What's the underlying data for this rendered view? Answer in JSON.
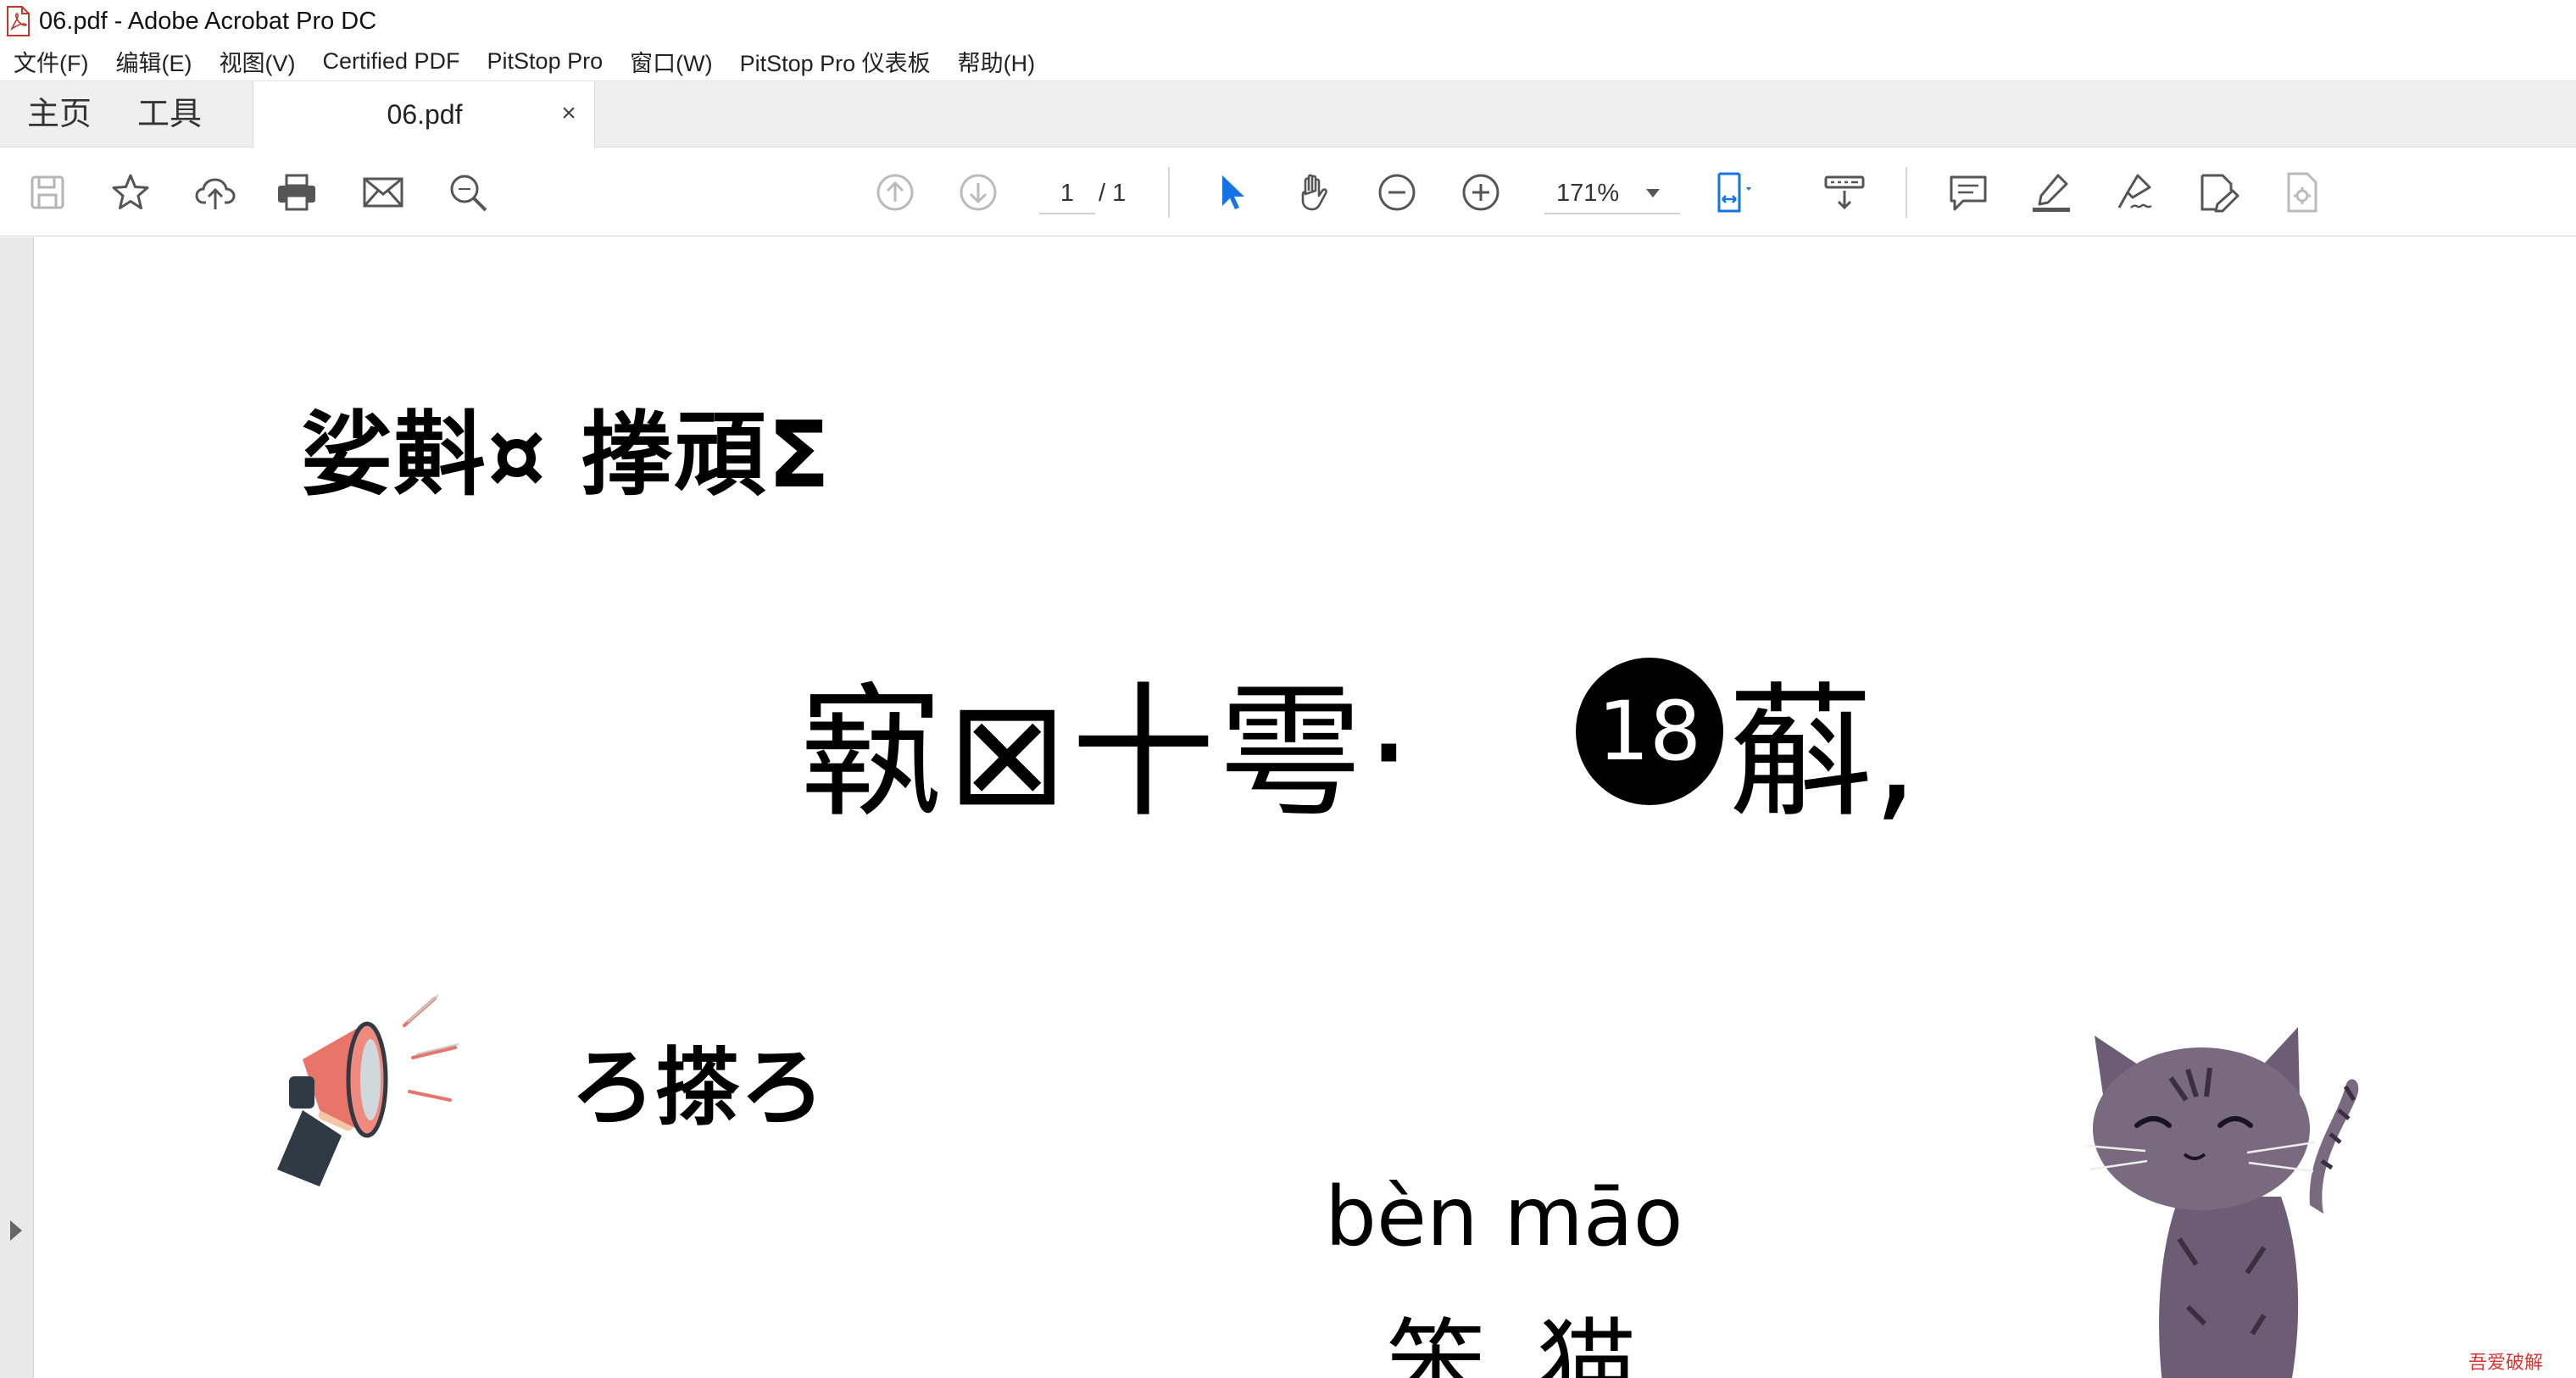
{
  "window": {
    "title": "06.pdf - Adobe Acrobat Pro DC",
    "app_icon": "pdf-file-icon"
  },
  "menu": [
    "文件(F)",
    "编辑(E)",
    "视图(V)",
    "Certified PDF",
    "PitStop Pro",
    "窗口(W)",
    "PitStop Pro 仪表板",
    "帮助(H)"
  ],
  "tabs": {
    "home": "主页",
    "tools": "工具",
    "document": "06.pdf",
    "close": "×"
  },
  "toolbar": {
    "page_current": "1",
    "page_total": "/ 1",
    "zoom": "171%",
    "icons": [
      "save-icon",
      "star-icon",
      "cloud-upload-icon",
      "print-icon",
      "email-icon",
      "search-zoom-icon",
      "page-up-icon",
      "page-down-icon",
      "select-arrow-icon",
      "hand-icon",
      "zoom-out-icon",
      "zoom-in-icon",
      "fit-page-icon",
      "keyboard-scroll-icon",
      "comment-icon",
      "highlight-icon",
      "sign-icon",
      "edit-pdf-icon",
      "tools-settings-icon"
    ],
    "accent_color": "#1473e6"
  },
  "document": {
    "heading": "娑斢¤ 搼頑Σ",
    "title_text": "㝪⊠十雩·",
    "circle_number": "18",
    "title_end": "蔛,",
    "subheading": "ろ搽ろ",
    "pinyin": "bèn māo",
    "hanzi": "笨猫"
  },
  "watermark": "吾爱破解"
}
